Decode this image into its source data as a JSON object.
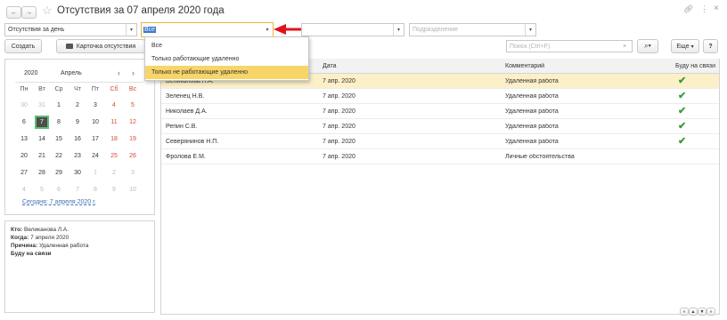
{
  "window": {
    "title": "Отсутствия за 07 апреля 2020 года",
    "nav_back": "←",
    "nav_forward": "→",
    "star": "☆",
    "link_icon": "🔗",
    "menu_icon": "⋮",
    "close_icon": "×"
  },
  "filters": {
    "period_value": "Отсутствия за день",
    "remote_filter_value": "Все",
    "employee_placeholder": "",
    "department_placeholder": "Подразделение"
  },
  "dropdown": {
    "options": [
      "Все",
      "Только работающие удаленно",
      "Только не работающие удаленно"
    ],
    "highlighted_index": 2
  },
  "toolbar": {
    "create_label": "Создать",
    "card_label": "Карточка отсутствия",
    "search_placeholder": "Поиск (Ctrl+F)",
    "more_label": "Еще",
    "help_label": "?"
  },
  "calendar": {
    "year": "2020",
    "month": "Апрель",
    "prev": "‹",
    "next": "›",
    "weekdays": [
      "Пн",
      "Вт",
      "Ср",
      "Чт",
      "Пт",
      "Сб",
      "Вс"
    ],
    "weeks": [
      [
        "30",
        "31",
        "1",
        "2",
        "3",
        "4",
        "5"
      ],
      [
        "6",
        "7",
        "8",
        "9",
        "10",
        "11",
        "12"
      ],
      [
        "13",
        "14",
        "15",
        "16",
        "17",
        "18",
        "19"
      ],
      [
        "20",
        "21",
        "22",
        "23",
        "24",
        "25",
        "26"
      ],
      [
        "27",
        "28",
        "29",
        "30",
        "1",
        "2",
        "3"
      ],
      [
        "4",
        "5",
        "6",
        "7",
        "8",
        "9",
        "10"
      ]
    ],
    "today_link": "Сегодня: 7 апреля 2020 г."
  },
  "details": {
    "who_label": "Кто:",
    "who_value": "Великанова Л.А.",
    "when_label": "Когда:",
    "when_value": "7 апреля 2020",
    "reason_label": "Причина:",
    "reason_value": "Удаленная работа",
    "status": "Буду на связи"
  },
  "table": {
    "columns": [
      "Дата",
      "Комментарий",
      "Буду на связи"
    ],
    "rows": [
      {
        "name": "Великанова Л.А.",
        "date": "7 апр. 2020",
        "comment": "Удаленная работа",
        "online": true
      },
      {
        "name": "Зеленец Н.В.",
        "date": "7 апр. 2020",
        "comment": "Удаленная работа",
        "online": true
      },
      {
        "name": "Николаев Д.А.",
        "date": "7 апр. 2020",
        "comment": "Удаленная работа",
        "online": true
      },
      {
        "name": "Репин С.В.",
        "date": "7 апр. 2020",
        "comment": "Удаленная работа",
        "online": true
      },
      {
        "name": "Северянинов Н.П.",
        "date": "7 апр. 2020",
        "comment": "Удаленная работа",
        "online": true
      },
      {
        "name": "Фролова Е.М.",
        "date": "7 апр. 2020",
        "comment": "Личные обстоятельства",
        "online": false
      }
    ],
    "check_mark": "✔"
  },
  "colors": {
    "selected_row": "#fbf0c8",
    "dropdown_highlight": "#f7d568",
    "arrow_red": "#e0121b",
    "weekend_red": "#d64a2e",
    "link_blue": "#3b72b6",
    "today_bg": "#4d4d4d"
  }
}
